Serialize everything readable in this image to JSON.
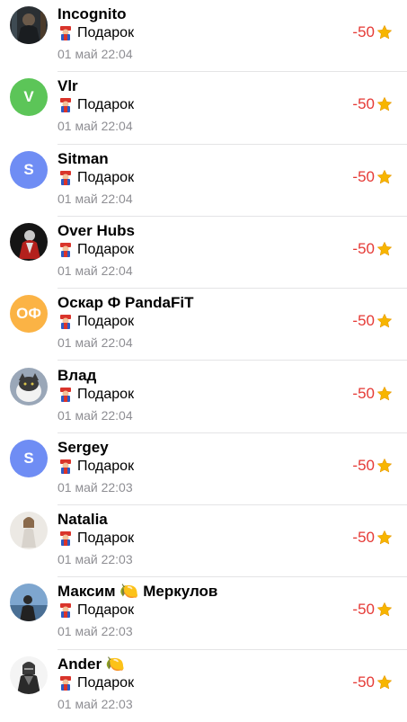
{
  "colors": {
    "amount": "#e53935",
    "time": "#8e8e93",
    "avatar_green": "#5cc558",
    "avatar_blue": "#6f8df4",
    "avatar_orange": "#fbb345"
  },
  "transactions": [
    {
      "name": "Incognito",
      "description": "Подарок",
      "time": "01 май 22:04",
      "amount": "-50",
      "avatar": {
        "type": "photo",
        "icon": "dark-portrait"
      }
    },
    {
      "name": "Vlr",
      "description": "Подарок",
      "time": "01 май 22:04",
      "amount": "-50",
      "avatar": {
        "type": "initials",
        "initials": "V",
        "color": "#5cc558"
      }
    },
    {
      "name": "Sitman",
      "description": "Подарок",
      "time": "01 май 22:04",
      "amount": "-50",
      "avatar": {
        "type": "initials",
        "initials": "S",
        "color": "#6f8df4"
      }
    },
    {
      "name": "Over Hubs",
      "description": "Подарок",
      "time": "01 май 22:04",
      "amount": "-50",
      "avatar": {
        "type": "photo",
        "icon": "red-figure"
      }
    },
    {
      "name": "Оскар Ф PandaFiT",
      "description": "Подарок",
      "time": "01 май 22:04",
      "amount": "-50",
      "avatar": {
        "type": "initials",
        "initials": "ОФ",
        "color": "#fbb345"
      }
    },
    {
      "name": "Влад",
      "description": "Подарок",
      "time": "01 май 22:04",
      "amount": "-50",
      "avatar": {
        "type": "photo",
        "icon": "cat-photo"
      }
    },
    {
      "name": "Sergey",
      "description": "Подарок",
      "time": "01 май 22:03",
      "amount": "-50",
      "avatar": {
        "type": "initials",
        "initials": "S",
        "color": "#6f8df4"
      }
    },
    {
      "name": "Natalia",
      "description": "Подарок",
      "time": "01 май 22:03",
      "amount": "-50",
      "avatar": {
        "type": "photo",
        "icon": "woman-photo"
      }
    },
    {
      "name": "Максим 🍋 Меркулов",
      "description": "Подарок",
      "time": "01 май 22:03",
      "amount": "-50",
      "avatar": {
        "type": "photo",
        "icon": "sea-photo"
      }
    },
    {
      "name": "Ander 🍋",
      "description": "Подарок",
      "time": "01 май 22:03",
      "amount": "-50",
      "avatar": {
        "type": "photo",
        "icon": "knight-photo"
      }
    }
  ]
}
